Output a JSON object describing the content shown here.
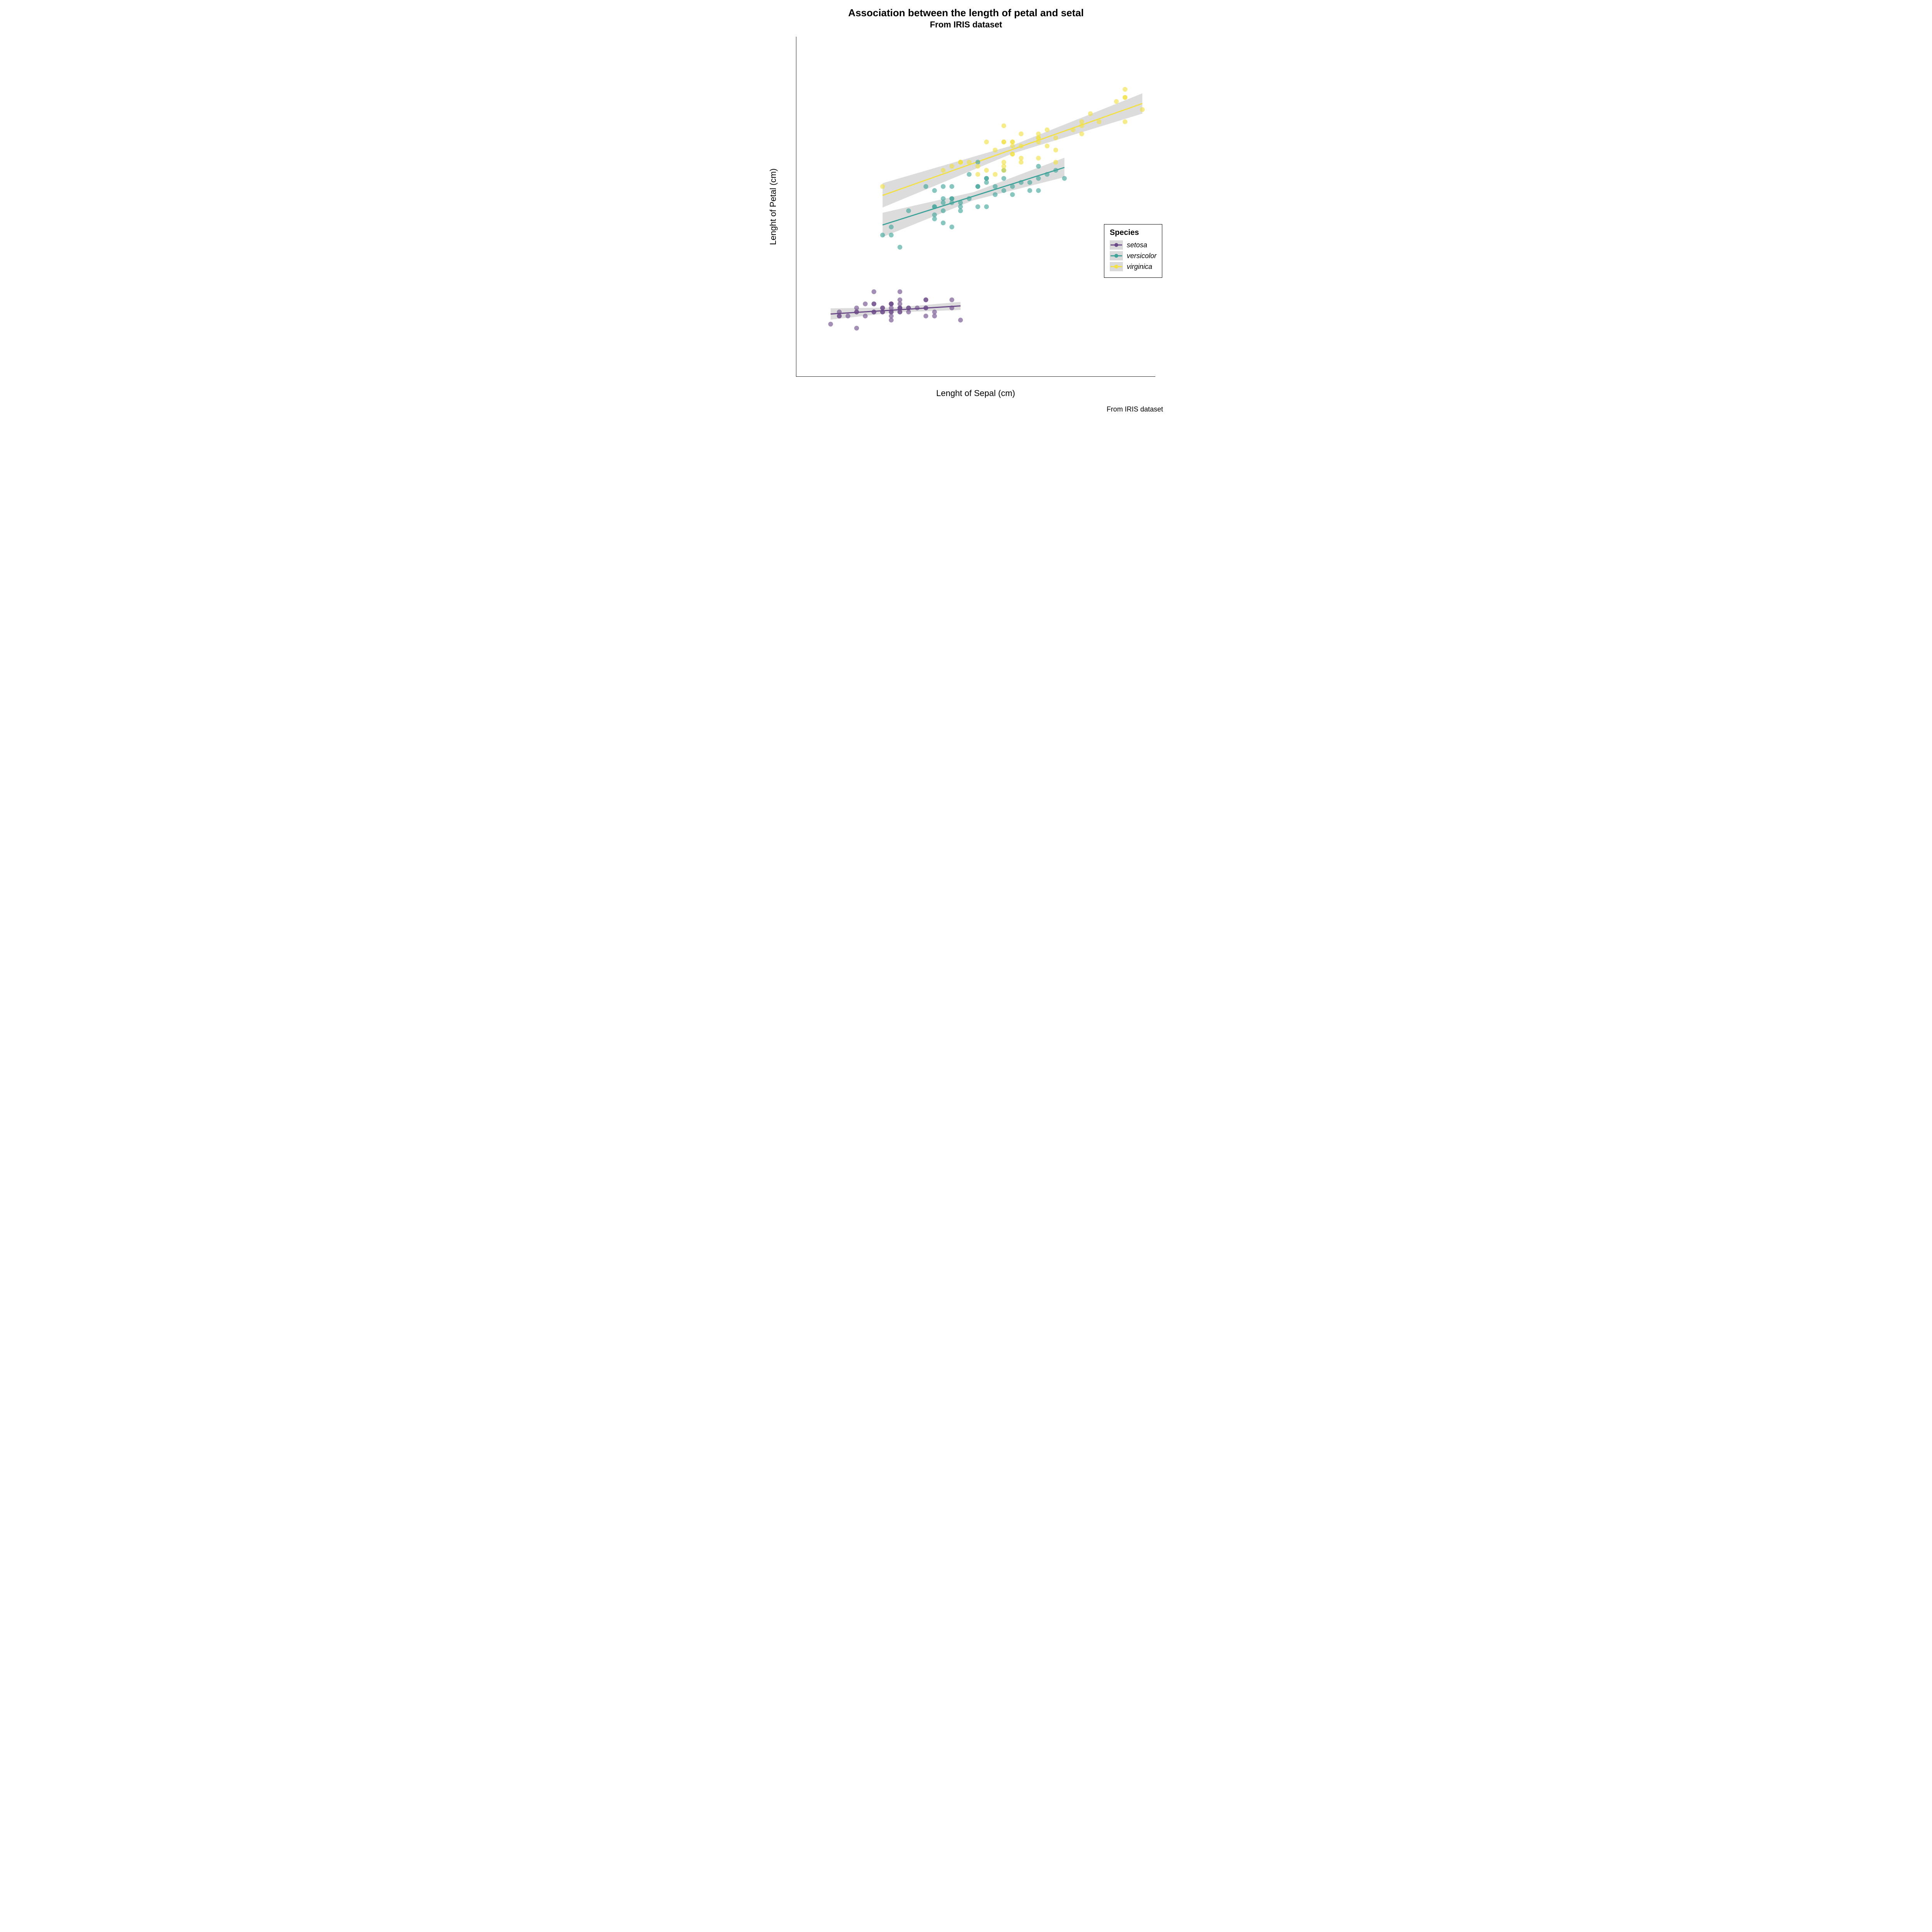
{
  "chart_data": {
    "type": "scatter",
    "title": "Association between the length of petal and setal",
    "subtitle": "From IRIS dataset",
    "caption": "From IRIS dataset",
    "xlabel": "Lenght of Sepal (cm)",
    "ylabel": "Lenght of Petal (cm)",
    "xlim": [
      3.9,
      8.05
    ],
    "ylim": [
      -0.2,
      8.2
    ],
    "xticks": [
      4,
      5,
      6,
      7,
      8
    ],
    "yticks": [
      0,
      2,
      4,
      6,
      8
    ],
    "legend_title": "Species",
    "legend_position": "right",
    "colors": {
      "setosa": "#6b4a88",
      "versicolor": "#3fa39a",
      "virginica": "#f2e045"
    },
    "series": [
      {
        "name": "setosa",
        "points": [
          [
            5.1,
            1.4
          ],
          [
            4.9,
            1.4
          ],
          [
            4.7,
            1.3
          ],
          [
            4.6,
            1.5
          ],
          [
            5.0,
            1.4
          ],
          [
            5.4,
            1.7
          ],
          [
            4.6,
            1.4
          ],
          [
            5.0,
            1.5
          ],
          [
            4.4,
            1.4
          ],
          [
            4.9,
            1.5
          ],
          [
            5.4,
            1.5
          ],
          [
            4.8,
            1.6
          ],
          [
            4.8,
            1.4
          ],
          [
            4.3,
            1.1
          ],
          [
            5.8,
            1.2
          ],
          [
            5.7,
            1.5
          ],
          [
            5.4,
            1.3
          ],
          [
            5.1,
            1.4
          ],
          [
            5.7,
            1.7
          ],
          [
            5.1,
            1.5
          ],
          [
            5.4,
            1.7
          ],
          [
            5.1,
            1.5
          ],
          [
            4.6,
            1.0
          ],
          [
            5.1,
            1.7
          ],
          [
            4.8,
            1.9
          ],
          [
            5.0,
            1.6
          ],
          [
            5.0,
            1.6
          ],
          [
            5.2,
            1.5
          ],
          [
            5.2,
            1.4
          ],
          [
            4.7,
            1.6
          ],
          [
            4.8,
            1.6
          ],
          [
            5.4,
            1.5
          ],
          [
            5.2,
            1.5
          ],
          [
            5.5,
            1.4
          ],
          [
            4.9,
            1.5
          ],
          [
            5.0,
            1.2
          ],
          [
            5.5,
            1.3
          ],
          [
            4.9,
            1.4
          ],
          [
            4.4,
            1.3
          ],
          [
            5.1,
            1.5
          ],
          [
            5.0,
            1.3
          ],
          [
            4.5,
            1.3
          ],
          [
            4.4,
            1.3
          ],
          [
            5.0,
            1.6
          ],
          [
            5.1,
            1.9
          ],
          [
            4.8,
            1.4
          ],
          [
            5.1,
            1.6
          ],
          [
            4.6,
            1.4
          ],
          [
            5.3,
            1.5
          ],
          [
            5.0,
            1.4
          ]
        ],
        "trend": {
          "x0": 4.3,
          "y0": 1.35,
          "x1": 5.8,
          "y1": 1.55
        },
        "ribbon_half": [
          0.14,
          0.06,
          0.1
        ]
      },
      {
        "name": "versicolor",
        "points": [
          [
            7.0,
            4.7
          ],
          [
            6.4,
            4.5
          ],
          [
            6.9,
            4.9
          ],
          [
            5.5,
            4.0
          ],
          [
            6.5,
            4.6
          ],
          [
            5.7,
            4.5
          ],
          [
            6.3,
            4.7
          ],
          [
            4.9,
            3.3
          ],
          [
            6.6,
            4.6
          ],
          [
            5.2,
            3.9
          ],
          [
            5.0,
            3.5
          ],
          [
            5.9,
            4.2
          ],
          [
            6.0,
            4.0
          ],
          [
            6.1,
            4.7
          ],
          [
            5.6,
            3.6
          ],
          [
            6.7,
            4.4
          ],
          [
            5.6,
            4.5
          ],
          [
            5.8,
            4.1
          ],
          [
            6.2,
            4.5
          ],
          [
            5.6,
            3.9
          ],
          [
            5.9,
            4.8
          ],
          [
            6.1,
            4.0
          ],
          [
            6.3,
            4.9
          ],
          [
            6.1,
            4.7
          ],
          [
            6.4,
            4.3
          ],
          [
            6.6,
            4.4
          ],
          [
            6.8,
            4.8
          ],
          [
            6.7,
            5.0
          ],
          [
            6.0,
            4.5
          ],
          [
            5.7,
            3.5
          ],
          [
            5.5,
            3.8
          ],
          [
            5.5,
            3.7
          ],
          [
            5.8,
            3.9
          ],
          [
            6.0,
            5.1
          ],
          [
            5.4,
            4.5
          ],
          [
            6.0,
            4.5
          ],
          [
            6.7,
            4.7
          ],
          [
            6.3,
            4.4
          ],
          [
            5.6,
            4.1
          ],
          [
            5.5,
            4.0
          ],
          [
            5.5,
            4.4
          ],
          [
            6.1,
            4.6
          ],
          [
            5.8,
            4.0
          ],
          [
            5.0,
            3.3
          ],
          [
            5.6,
            4.2
          ],
          [
            5.7,
            4.2
          ],
          [
            5.7,
            4.2
          ],
          [
            6.2,
            4.3
          ],
          [
            5.1,
            3.0
          ],
          [
            5.7,
            4.1
          ]
        ],
        "trend": {
          "x0": 4.9,
          "y0": 3.55,
          "x1": 7.0,
          "y1": 4.97
        },
        "ribbon_half": [
          0.3,
          0.1,
          0.24
        ]
      },
      {
        "name": "virginica",
        "points": [
          [
            6.3,
            6.0
          ],
          [
            5.8,
            5.1
          ],
          [
            7.1,
            5.9
          ],
          [
            6.3,
            5.6
          ],
          [
            6.5,
            5.8
          ],
          [
            7.6,
            6.6
          ],
          [
            4.9,
            4.5
          ],
          [
            7.3,
            6.3
          ],
          [
            6.7,
            5.8
          ],
          [
            7.2,
            6.1
          ],
          [
            6.5,
            5.1
          ],
          [
            6.4,
            5.3
          ],
          [
            6.8,
            5.5
          ],
          [
            5.7,
            5.0
          ],
          [
            5.8,
            5.1
          ],
          [
            6.4,
            5.3
          ],
          [
            6.5,
            5.5
          ],
          [
            7.7,
            6.7
          ],
          [
            7.7,
            6.9
          ],
          [
            6.0,
            5.0
          ],
          [
            6.9,
            5.7
          ],
          [
            5.6,
            4.9
          ],
          [
            7.7,
            6.7
          ],
          [
            6.3,
            4.9
          ],
          [
            6.7,
            5.7
          ],
          [
            7.2,
            6.0
          ],
          [
            6.2,
            4.8
          ],
          [
            6.1,
            4.9
          ],
          [
            6.4,
            5.6
          ],
          [
            7.2,
            5.8
          ],
          [
            7.4,
            6.1
          ],
          [
            7.9,
            6.4
          ],
          [
            6.4,
            5.6
          ],
          [
            6.3,
            5.1
          ],
          [
            6.1,
            5.6
          ],
          [
            7.7,
            6.1
          ],
          [
            6.3,
            5.6
          ],
          [
            6.4,
            5.5
          ],
          [
            6.0,
            4.8
          ],
          [
            6.9,
            5.4
          ],
          [
            6.7,
            5.6
          ],
          [
            6.9,
            5.1
          ],
          [
            5.8,
            5.1
          ],
          [
            6.8,
            5.9
          ],
          [
            6.7,
            5.7
          ],
          [
            6.7,
            5.2
          ],
          [
            6.3,
            5.0
          ],
          [
            6.5,
            5.2
          ],
          [
            6.2,
            5.4
          ],
          [
            5.9,
            5.1
          ]
        ],
        "trend": {
          "x0": 4.9,
          "y0": 4.28,
          "x1": 7.9,
          "y1": 6.55
        },
        "ribbon_half": [
          0.3,
          0.1,
          0.25
        ]
      }
    ]
  }
}
